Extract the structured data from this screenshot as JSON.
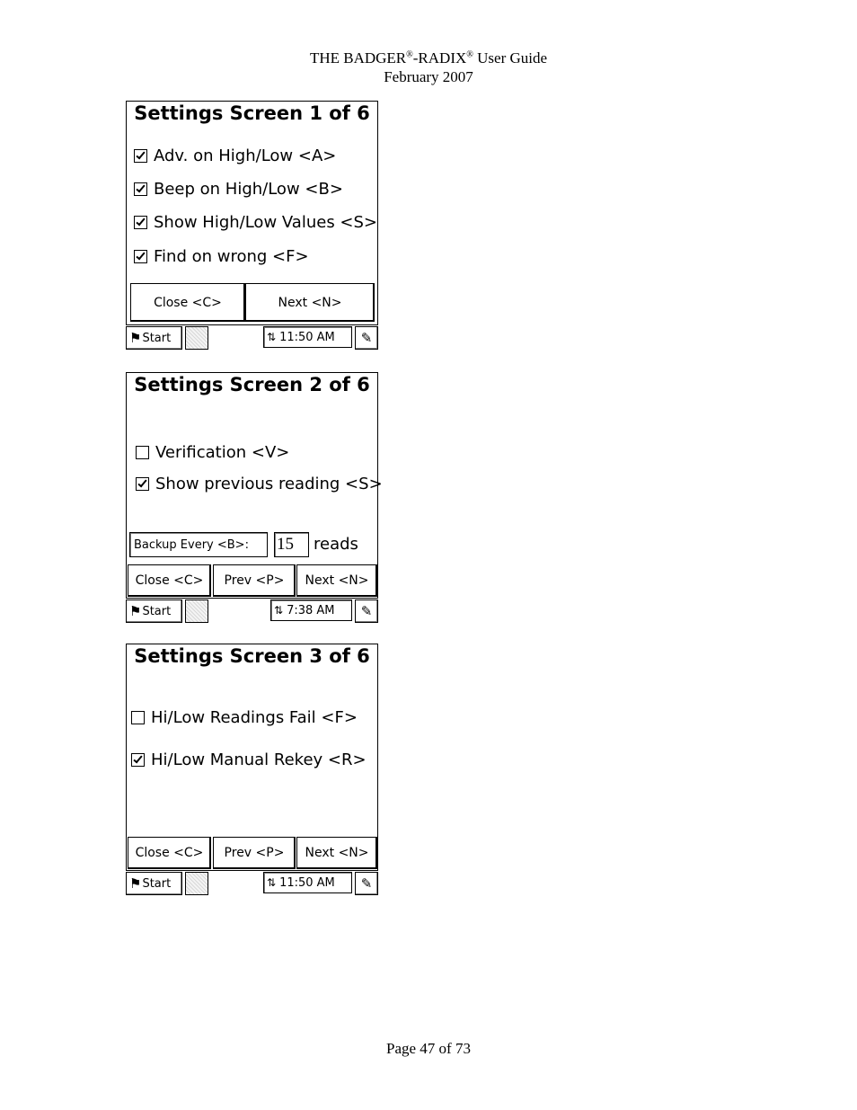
{
  "header": {
    "title_part1": "THE BADGER",
    "reg_mark_1": "®",
    "title_part2": "-RADIX",
    "reg_mark_2": "®",
    "title_part3": " User Guide",
    "date": "February 2007"
  },
  "footer": {
    "page": "Page 47 of 73"
  },
  "screen1": {
    "title": "Settings Screen 1 of 6",
    "options": [
      {
        "label": "Adv. on High/Low <A>",
        "checked": true
      },
      {
        "label": "Beep on High/Low <B>",
        "checked": true
      },
      {
        "label": "Show High/Low Values <S>",
        "checked": true
      },
      {
        "label": "Find on wrong <F>",
        "checked": true
      }
    ],
    "buttons": {
      "close": "Close <C>",
      "next": "Next <N>"
    },
    "taskbar": {
      "start": "Start",
      "time": "11:50 AM"
    }
  },
  "screen2": {
    "title": "Settings Screen 2 of 6",
    "options": [
      {
        "label": "Verification <V>",
        "checked": false
      },
      {
        "label": "Show previous reading <S>",
        "checked": true
      }
    ],
    "backup": {
      "label": "Backup Every <B>:",
      "value": "15",
      "unit": "reads"
    },
    "buttons": {
      "close": "Close <C>",
      "prev": "Prev <P>",
      "next": "Next <N>"
    },
    "taskbar": {
      "start": "Start",
      "time": "7:38 AM"
    }
  },
  "screen3": {
    "title": "Settings Screen 3 of 6",
    "options": [
      {
        "label": "Hi/Low Readings Fail <F>",
        "checked": false
      },
      {
        "label": "Hi/Low Manual Rekey <R>",
        "checked": true
      }
    ],
    "buttons": {
      "close": "Close <C>",
      "prev": "Prev <P>",
      "next": "Next <N>"
    },
    "taskbar": {
      "start": "Start",
      "time": "11:50 AM"
    }
  },
  "icons": {
    "start": "windows-flag-icon",
    "network": "network-connection-icon",
    "input_panel": "input-panel-pen-icon",
    "checkmark": "checkmark-icon"
  }
}
